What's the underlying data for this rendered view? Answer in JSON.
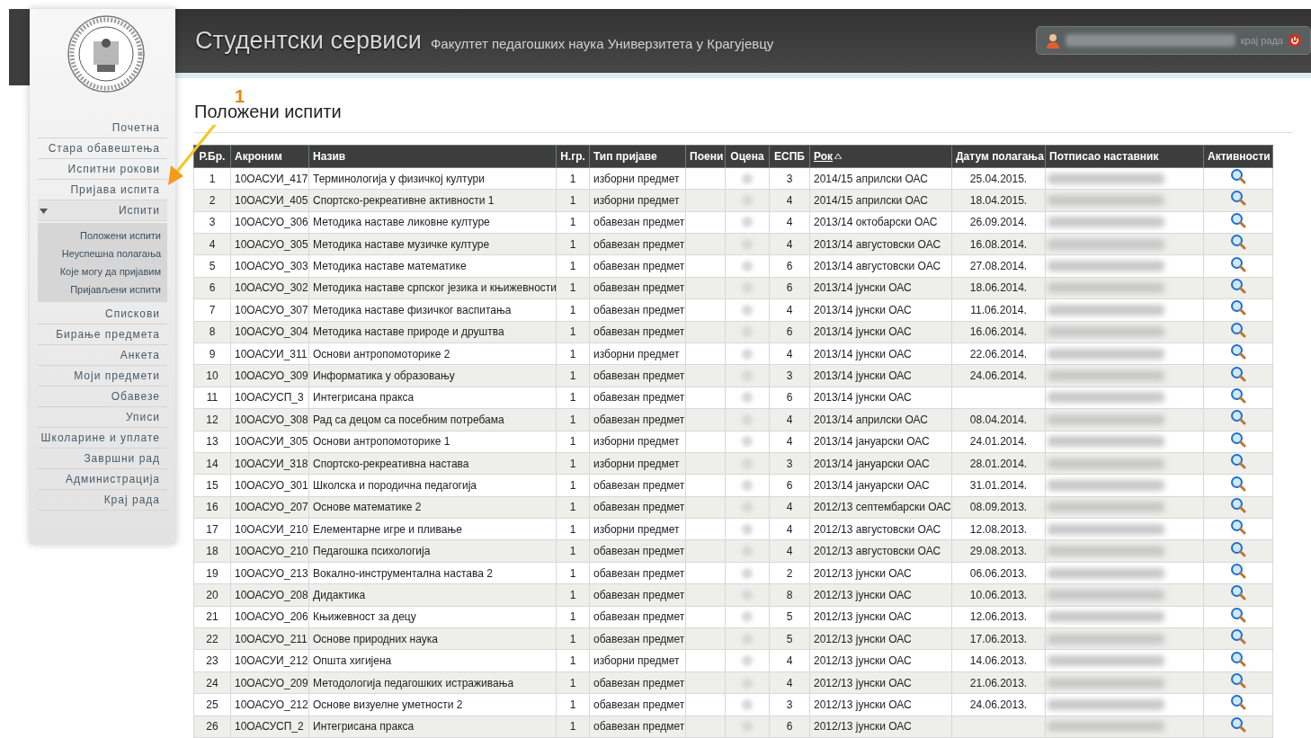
{
  "header": {
    "title": "Студентски сервиси",
    "subtitle": "Факултет педагошких наука Универзитета у Крагујевцу",
    "user_box": {
      "logout": "крај рада"
    }
  },
  "annotation": {
    "number": "1"
  },
  "sidebar": {
    "items": [
      {
        "label": "Почетна",
        "expanded": false
      },
      {
        "label": "Стара обавештења",
        "expanded": false
      },
      {
        "label": "Испитни рокови",
        "expanded": false
      },
      {
        "label": "Пријава испита",
        "expanded": false
      },
      {
        "label": "Испити",
        "expanded": true,
        "children": [
          {
            "label": "Положени испити"
          },
          {
            "label": "Неуспешна полагања"
          },
          {
            "label": "Које могу да пријавим"
          },
          {
            "label": "Пријављени испити"
          }
        ]
      },
      {
        "label": "Спискови",
        "expanded": false
      },
      {
        "label": "Бирање предмета",
        "expanded": false
      },
      {
        "label": "Анкета",
        "expanded": false
      },
      {
        "label": "Моји предмети",
        "expanded": false
      },
      {
        "label": "Обавезе",
        "expanded": false
      },
      {
        "label": "Уписи",
        "expanded": false
      },
      {
        "label": "Школарине и уплате",
        "expanded": false
      },
      {
        "label": "Завршни рад",
        "expanded": false
      },
      {
        "label": "Администрација",
        "expanded": false
      },
      {
        "label": "Крај рада",
        "expanded": false
      }
    ]
  },
  "page_title": "Положени испити",
  "table": {
    "columns": [
      {
        "label": "Р.Бр.",
        "sorted": false
      },
      {
        "label": "Акроним",
        "sorted": false
      },
      {
        "label": "Назив",
        "sorted": false
      },
      {
        "label": "Н.гр.",
        "sorted": false
      },
      {
        "label": "Тип пријаве",
        "sorted": false
      },
      {
        "label": "Поени",
        "sorted": false
      },
      {
        "label": "Оцена",
        "sorted": false
      },
      {
        "label": "ЕСПБ",
        "sorted": false
      },
      {
        "label": "Рок",
        "sorted": true
      },
      {
        "label": "Датум полагања",
        "sorted": false
      },
      {
        "label": "Потписао наставник",
        "sorted": false
      },
      {
        "label": "Активности",
        "sorted": false
      }
    ],
    "rows": [
      {
        "no": "1",
        "acronym": "10ОАСУИ_417",
        "name": "Терминологија у физичкој култури",
        "group": "1",
        "type": "изборни предмет",
        "ects": "3",
        "term": "2014/15 априлски ОАС",
        "date": "25.04.2015."
      },
      {
        "no": "2",
        "acronym": "10ОАСУИ_405",
        "name": "Спортско-рекреативне активности 1",
        "group": "1",
        "type": "изборни предмет",
        "ects": "4",
        "term": "2014/15 априлски ОАС",
        "date": "18.04.2015."
      },
      {
        "no": "3",
        "acronym": "10ОАСУО_306",
        "name": "Методика наставе ликовне културе",
        "group": "1",
        "type": "обавезан предмет",
        "ects": "4",
        "term": "2013/14 октобарски ОАС",
        "date": "26.09.2014."
      },
      {
        "no": "4",
        "acronym": "10ОАСУО_305",
        "name": "Методика наставе музичке културе",
        "group": "1",
        "type": "обавезан предмет",
        "ects": "4",
        "term": "2013/14 августовски ОАС",
        "date": "16.08.2014."
      },
      {
        "no": "5",
        "acronym": "10ОАСУО_303",
        "name": "Методика наставе математике",
        "group": "1",
        "type": "обавезан предмет",
        "ects": "6",
        "term": "2013/14 августовски ОАС",
        "date": "27.08.2014."
      },
      {
        "no": "6",
        "acronym": "10ОАСУО_302",
        "name": "Методика наставе српског језика и књижевности",
        "group": "1",
        "type": "обавезан предмет",
        "ects": "6",
        "term": "2013/14 јунски ОАС",
        "date": "18.06.2014."
      },
      {
        "no": "7",
        "acronym": "10ОАСУО_307",
        "name": "Методика наставе физичког васпитања",
        "group": "1",
        "type": "обавезан предмет",
        "ects": "4",
        "term": "2013/14 јунски ОАС",
        "date": "11.06.2014."
      },
      {
        "no": "8",
        "acronym": "10ОАСУО_304",
        "name": "Методика наставе природе и друштва",
        "group": "1",
        "type": "обавезан предмет",
        "ects": "6",
        "term": "2013/14 јунски ОАС",
        "date": "16.06.2014."
      },
      {
        "no": "9",
        "acronym": "10ОАСУИ_311",
        "name": "Основи антропомоторике 2",
        "group": "1",
        "type": "изборни предмет",
        "ects": "4",
        "term": "2013/14 јунски ОАС",
        "date": "22.06.2014."
      },
      {
        "no": "10",
        "acronym": "10ОАСУО_309",
        "name": "Информатика у образовању",
        "group": "1",
        "type": "обавезан предмет",
        "ects": "3",
        "term": "2013/14 јунски ОАС",
        "date": "24.06.2014."
      },
      {
        "no": "11",
        "acronym": "10ОАСУСП_3",
        "name": "Интегрисана пракса",
        "group": "1",
        "type": "обавезан предмет",
        "ects": "6",
        "term": "2013/14 јунски ОАС"
      },
      {
        "no": "12",
        "acronym": "10ОАСУО_308",
        "name": "Рад са децом са посебним потребама",
        "group": "1",
        "type": "обавезан предмет",
        "ects": "4",
        "term": "2013/14 априлски ОАС",
        "date": "08.04.2014."
      },
      {
        "no": "13",
        "acronym": "10ОАСУИ_305",
        "name": "Основи антропомоторике 1",
        "group": "1",
        "type": "изборни предмет",
        "ects": "4",
        "term": "2013/14 јануарски ОАС",
        "date": "24.01.2014."
      },
      {
        "no": "14",
        "acronym": "10ОАСУИ_318",
        "name": "Спортско-рекреативна настава",
        "group": "1",
        "type": "изборни предмет",
        "ects": "3",
        "term": "2013/14 јануарски ОАС",
        "date": "28.01.2014."
      },
      {
        "no": "15",
        "acronym": "10ОАСУО_301",
        "name": "Школска и породична педагогија",
        "group": "1",
        "type": "обавезан предмет",
        "ects": "6",
        "term": "2013/14 јануарски ОАС",
        "date": "31.01.2014."
      },
      {
        "no": "16",
        "acronym": "10ОАСУО_207",
        "name": "Основе математике 2",
        "group": "1",
        "type": "обавезан предмет",
        "ects": "4",
        "term": "2012/13 септембарски ОАС",
        "date": "08.09.2013."
      },
      {
        "no": "17",
        "acronym": "10ОАСУИ_210",
        "name": "Елементарне игре и пливање",
        "group": "1",
        "type": "изборни предмет",
        "ects": "4",
        "term": "2012/13 августовски ОАС",
        "date": "12.08.2013."
      },
      {
        "no": "18",
        "acronym": "10ОАСУО_210",
        "name": "Педагошка психологија",
        "group": "1",
        "type": "обавезан предмет",
        "ects": "4",
        "term": "2012/13 августовски ОАС",
        "date": "29.08.2013."
      },
      {
        "no": "19",
        "acronym": "10ОАСУО_213",
        "name": "Вокално-инструментална настава 2",
        "group": "1",
        "type": "обавезан предмет",
        "ects": "2",
        "term": "2012/13 јунски ОАС",
        "date": "06.06.2013."
      },
      {
        "no": "20",
        "acronym": "10ОАСУО_208",
        "name": "Дидактика",
        "group": "1",
        "type": "обавезан предмет",
        "ects": "8",
        "term": "2012/13 јунски ОАС",
        "date": "10.06.2013."
      },
      {
        "no": "21",
        "acronym": "10ОАСУО_206",
        "name": "Књижевност за децу",
        "group": "1",
        "type": "обавезан предмет",
        "ects": "5",
        "term": "2012/13 јунски ОАС",
        "date": "12.06.2013."
      },
      {
        "no": "22",
        "acronym": "10ОАСУО_211",
        "name": "Основе природних наука",
        "group": "1",
        "type": "обавезан предмет",
        "ects": "5",
        "term": "2012/13 јунски ОАС",
        "date": "17.06.2013."
      },
      {
        "no": "23",
        "acronym": "10ОАСУИ_212",
        "name": "Општа хигијена",
        "group": "1",
        "type": "изборни предмет",
        "ects": "4",
        "term": "2012/13 јунски ОАС",
        "date": "14.06.2013."
      },
      {
        "no": "24",
        "acronym": "10ОАСУО_209",
        "name": "Методологија педагошких истраживања",
        "group": "1",
        "type": "обавезан предмет",
        "ects": "4",
        "term": "2012/13 јунски ОАС",
        "date": "21.06.2013."
      },
      {
        "no": "25",
        "acronym": "10ОАСУО_212",
        "name": "Основе визуелне уметности 2",
        "group": "1",
        "type": "обавезан предмет",
        "ects": "3",
        "term": "2012/13 јунски ОАС",
        "date": "24.06.2013."
      },
      {
        "no": "26",
        "acronym": "10ОАСУСП_2",
        "name": "Интегрисана пракса",
        "group": "1",
        "type": "обавезан предмет",
        "ects": "6",
        "term": "2012/13 јунски ОАС"
      }
    ]
  }
}
